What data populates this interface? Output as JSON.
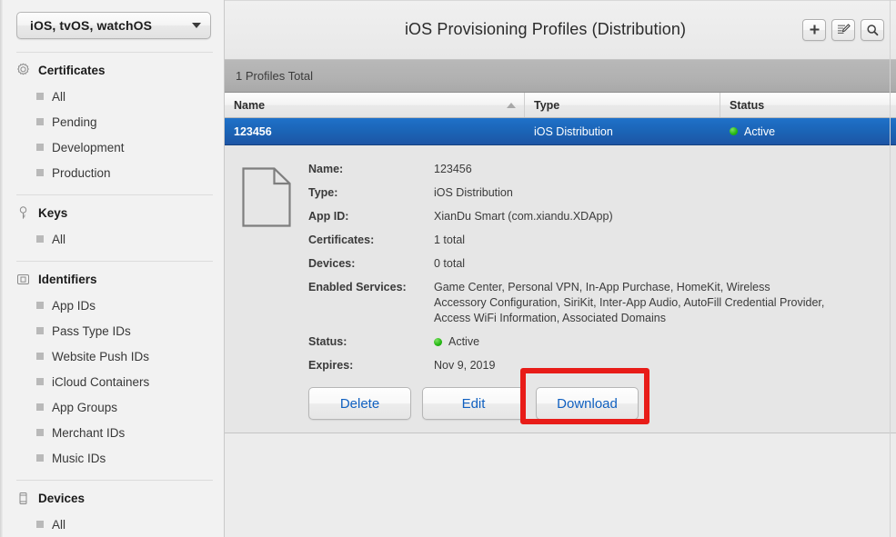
{
  "sidebar": {
    "os_select": {
      "label": "iOS, tvOS, watchOS",
      "caret": "chevron-down-icon"
    },
    "groups": [
      {
        "id": "certificates",
        "icon": "certificate-seal-icon",
        "label": "Certificates",
        "items": [
          "All",
          "Pending",
          "Development",
          "Production"
        ]
      },
      {
        "id": "keys",
        "icon": "key-icon",
        "label": "Keys",
        "items": [
          "All"
        ]
      },
      {
        "id": "identifiers",
        "icon": "id-badge-icon",
        "label": "Identifiers",
        "items": [
          "App IDs",
          "Pass Type IDs",
          "Website Push IDs",
          "iCloud Containers",
          "App Groups",
          "Merchant IDs",
          "Music IDs"
        ]
      },
      {
        "id": "devices",
        "icon": "device-phone-icon",
        "label": "Devices",
        "items": [
          "All"
        ]
      }
    ]
  },
  "header": {
    "title": "iOS Provisioning Profiles (Distribution)",
    "actions": [
      {
        "id": "add",
        "icon": "plus-icon",
        "tooltip": "Add"
      },
      {
        "id": "edit",
        "icon": "edit-pencil-icon",
        "tooltip": "Edit"
      },
      {
        "id": "search",
        "icon": "search-icon",
        "tooltip": "Search"
      }
    ]
  },
  "list": {
    "count_text": "1 Profiles Total",
    "columns": [
      "Name",
      "Type",
      "Status"
    ],
    "sort_column": "Name",
    "sort_direction": "asc",
    "rows": [
      {
        "name": "123456",
        "type": "iOS Distribution",
        "status": "Active",
        "status_color": "#24b415",
        "selected": true
      }
    ]
  },
  "detail": {
    "icon": "document-icon",
    "fields": [
      {
        "label": "Name:",
        "value": "123456"
      },
      {
        "label": "Type:",
        "value": "iOS Distribution"
      },
      {
        "label": "App ID:",
        "value": "XianDu Smart (com.xiandu.XDApp)"
      },
      {
        "label": "Certificates:",
        "value": "1 total"
      },
      {
        "label": "Devices:",
        "value": "0 total"
      },
      {
        "label": "Enabled Services:",
        "value": "Game Center, Personal VPN, In-App Purchase, HomeKit, Wireless Accessory Configuration, SiriKit, Inter-App Audio, AutoFill Credential Provider, Access WiFi Information, Associated Domains"
      },
      {
        "label": "Status:",
        "value": "Active",
        "has_dot": true,
        "dot_color": "#24b415"
      },
      {
        "label": "Expires:",
        "value": "Nov 9, 2019"
      }
    ],
    "buttons": [
      {
        "id": "delete",
        "label": "Delete",
        "highlighted": false
      },
      {
        "id": "edit",
        "label": "Edit",
        "highlighted": false
      },
      {
        "id": "download",
        "label": "Download",
        "highlighted": true
      }
    ]
  },
  "annotation": {
    "highlight_color": "#e81c18",
    "target": "download"
  }
}
